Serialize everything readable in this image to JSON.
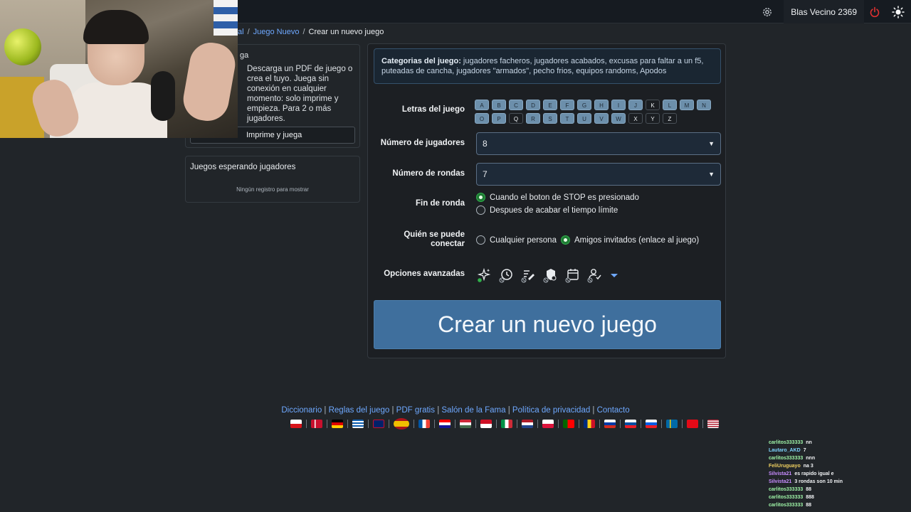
{
  "navbar": {
    "user_name": "Blas Vecino 2369",
    "icons": {
      "settings": "gear-icon",
      "logout": "power-icon",
      "theme": "sun-icon"
    }
  },
  "breadcrumb": {
    "items": [
      "al",
      "Juego Nuevo"
    ],
    "current": "Crear un nuevo juego"
  },
  "print_card": {
    "heading": "ga",
    "text": "Descarga un PDF de juego o crea el tuyo. Juega sin conexión en cualquier momento: solo imprime y empieza. Para 2 o más jugadores.",
    "button_label": "Imprime y juega"
  },
  "waiting_card": {
    "title": "Juegos esperando jugadores",
    "empty_text": "Ningún registro para mostrar"
  },
  "form": {
    "categories_label": "Categorias del juego:",
    "categories_text": " jugadores facheros, jugadores acabados, excusas para faltar a un f5, puteadas de cancha, jugadores \"armados\", pecho frios, equipos randoms, Apodos",
    "letters_label": "Letras del juego",
    "letters_row1": [
      "A",
      "B",
      "C",
      "D",
      "E",
      "F",
      "G",
      "H",
      "I",
      "J",
      "K",
      "L",
      "M",
      "N"
    ],
    "letters_row2": [
      "O",
      "P",
      "Q",
      "R",
      "S",
      "T",
      "U",
      "V",
      "W",
      "X",
      "Y",
      "Z"
    ],
    "letters_off": [
      "K",
      "Q",
      "X",
      "Y",
      "Z"
    ],
    "players_label": "Número de jugadores",
    "players_value": "8",
    "rounds_label": "Número de rondas",
    "rounds_value": "7",
    "round_end_label": "Fin de ronda",
    "round_end_options": [
      "Cuando el boton de STOP es presionado",
      "Despues de acabar el tiempo límite"
    ],
    "round_end_selected": 0,
    "who_label_1": "Quién se puede",
    "who_label_2": "conectar",
    "who_options": [
      "Cualquier persona",
      "Amigos invitados (enlace al juego)"
    ],
    "who_selected": 1,
    "advanced_label": "Opciones avanzadas",
    "advanced_icons": [
      "sparkle-icon",
      "clock-icon",
      "edit-list-icon",
      "shield-icon",
      "calendar-icon",
      "user-check-icon"
    ],
    "create_button": "Crear un nuevo juego"
  },
  "footer": {
    "links": [
      "Diccionario",
      "Reglas del juego",
      "PDF gratis",
      "Salón de la Fama",
      "Política de privacidad",
      "Contacto"
    ]
  },
  "chat": [
    {
      "user": "carlitos333333",
      "msg": "nn",
      "color": "#9ff5a8"
    },
    {
      "user": "Lautaro_AKD",
      "msg": "7",
      "color": "#7fd6ff"
    },
    {
      "user": "carlitos333333",
      "msg": "nnn",
      "color": "#9ff5a8"
    },
    {
      "user": "FeliUruguayo",
      "msg": "na 3",
      "color": "#f0d060"
    },
    {
      "user": "Silvista21",
      "msg": "es rapido igual e",
      "color": "#c88cff"
    },
    {
      "user": "Silvista21",
      "msg": "3 rondas son 10 min",
      "color": "#c88cff"
    },
    {
      "user": "carlitos333333",
      "msg": "88",
      "color": "#9ff5a8"
    },
    {
      "user": "carlitos333333",
      "msg": "888",
      "color": "#9ff5a8"
    },
    {
      "user": "carlitos333333",
      "msg": "88",
      "color": "#9ff5a8"
    }
  ],
  "colors": {
    "accent": "#3f6f9d",
    "link": "#6ea8fe",
    "radio_on": "#2fb14a",
    "logout": "#e03131"
  }
}
